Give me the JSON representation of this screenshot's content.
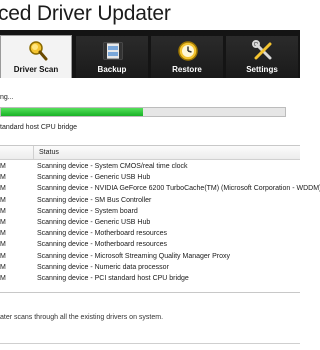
{
  "app": {
    "title": "ced Driver Updater"
  },
  "tabs": [
    {
      "label": "Driver Scan",
      "icon": "magnifier-icon",
      "active": true
    },
    {
      "label": "Backup",
      "icon": "film-backup-icon",
      "active": false
    },
    {
      "label": "Restore",
      "icon": "clock-restore-icon",
      "active": false
    },
    {
      "label": "Settings",
      "icon": "tools-icon",
      "active": false
    }
  ],
  "scan": {
    "status": "ng...",
    "progress": 0.5,
    "current_device": "tandard host CPU bridge"
  },
  "log": {
    "columns": {
      "time": "",
      "status": "Status"
    },
    "rows": [
      {
        "time": "M",
        "status": "Scanning device - System CMOS/real time clock"
      },
      {
        "time": "M",
        "status": "Scanning device - Generic USB Hub"
      },
      {
        "time": "M",
        "status": "Scanning device - NVIDIA GeForce 6200 TurboCache(TM) (Microsoft Corporation - WDDM)"
      },
      {
        "time": "M",
        "status": "Scanning device - SM Bus Controller"
      },
      {
        "time": "M",
        "status": "Scanning device - System board"
      },
      {
        "time": "M",
        "status": "Scanning device - Generic USB Hub"
      },
      {
        "time": "M",
        "status": "Scanning device - Motherboard resources"
      },
      {
        "time": "M",
        "status": "Scanning device - Motherboard resources"
      },
      {
        "time": "M",
        "status": "Scanning device - Microsoft Streaming Quality Manager Proxy"
      },
      {
        "time": "M",
        "status": "Scanning device - Numeric data processor"
      },
      {
        "time": "M",
        "status": "Scanning device - PCI standard host CPU bridge"
      }
    ]
  },
  "footer": {
    "text": "ater scans through all the existing drivers on system."
  },
  "colors": {
    "progress": "#18b226",
    "toolbar": "#141414"
  }
}
